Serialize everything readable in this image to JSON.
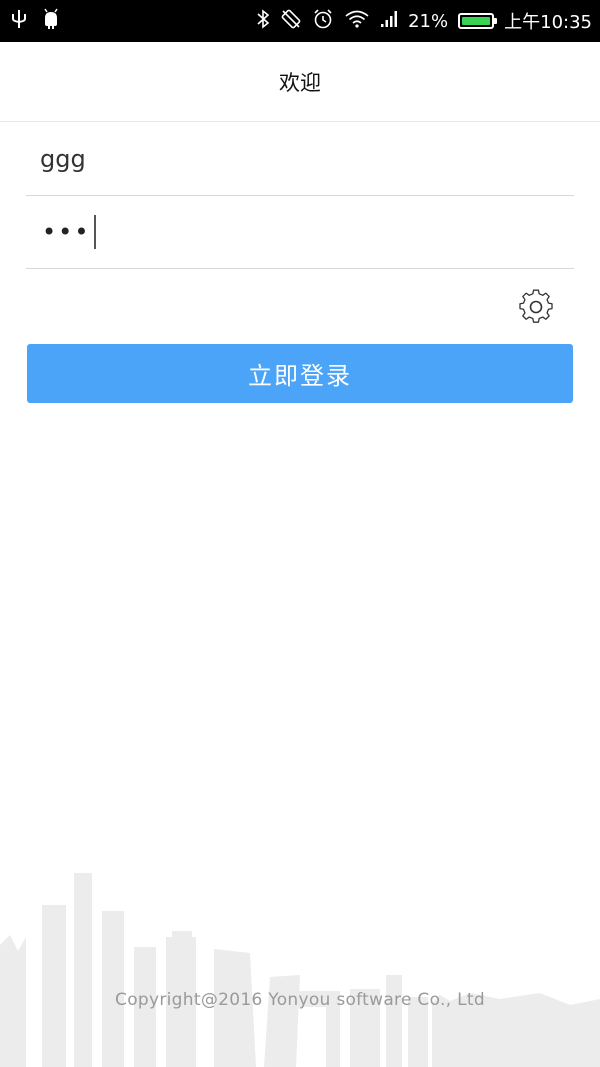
{
  "status_bar": {
    "battery_percent_text": "21%",
    "battery_level": 0.21,
    "time": "上午10:35",
    "icons": [
      "usb-icon",
      "android-debug-icon",
      "bluetooth-icon",
      "rotation-icon",
      "alarm-icon",
      "wifi-icon",
      "signal-icon",
      "battery-icon"
    ]
  },
  "header": {
    "title": "欢迎"
  },
  "login_form": {
    "username_value": "ggg",
    "password_masked": "•••",
    "settings_icon": "gear-icon",
    "login_label": "立即登录"
  },
  "footer": {
    "copyright": "Copyright@2016 Yonyou software Co., Ltd"
  },
  "colors": {
    "primary_button": "#4ba4f8",
    "battery_fill": "#39d353",
    "skyline": "#ececec"
  }
}
